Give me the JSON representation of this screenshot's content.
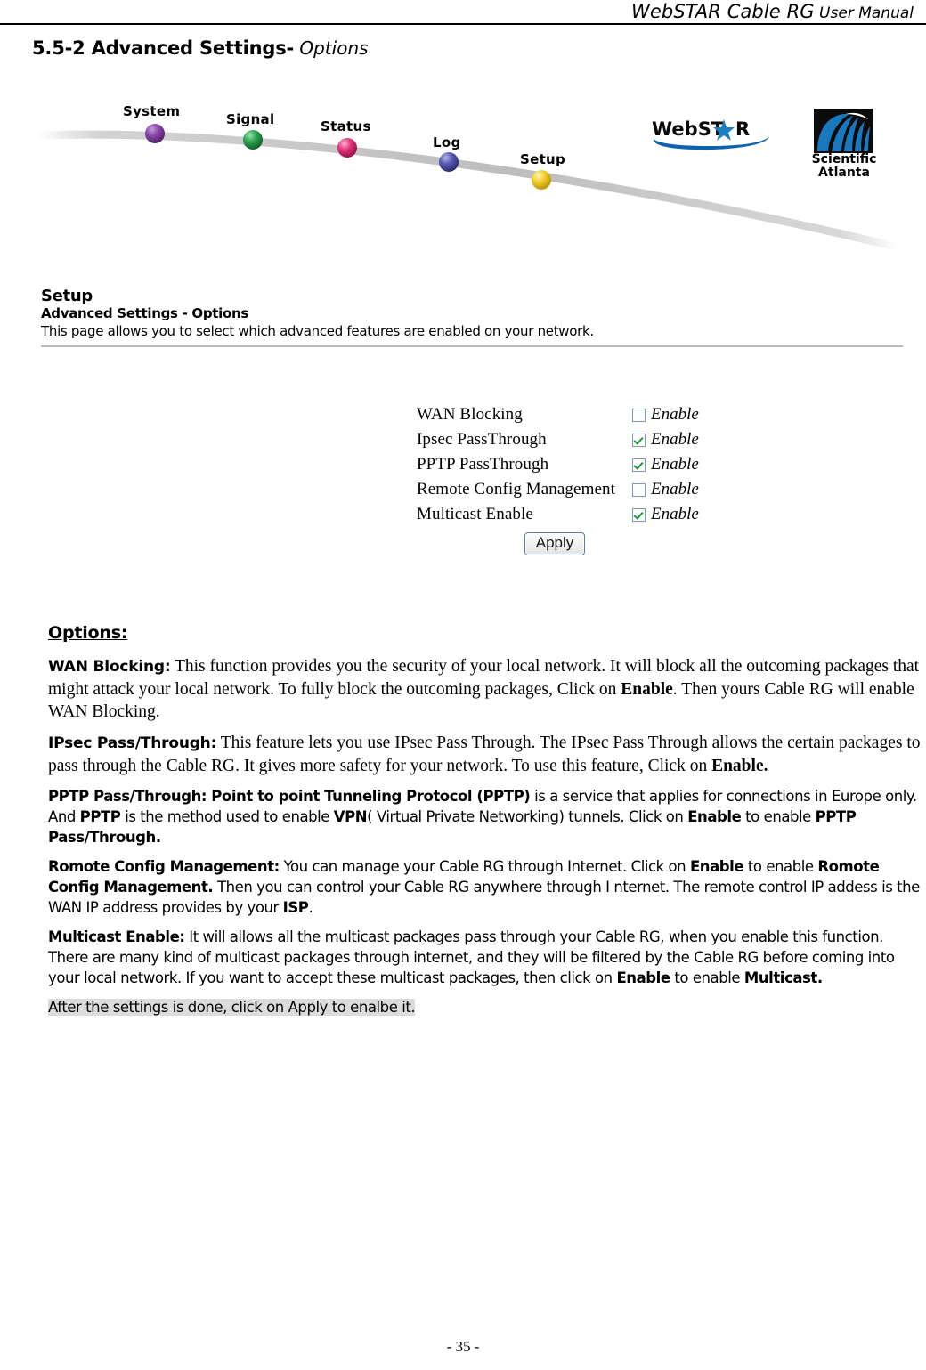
{
  "header": {
    "title_main": "WebSTAR Cable RG",
    "title_sub": " User Manual"
  },
  "section": {
    "number_title": "5.5-2 Advanced Settings-",
    "subtitle": " Options"
  },
  "router_ui": {
    "nav": {
      "items": [
        {
          "label": "System",
          "color": "#7b3fa0"
        },
        {
          "label": "Signal",
          "color": "#2aa34a"
        },
        {
          "label": "Status",
          "color": "#e0357e"
        },
        {
          "label": "Log",
          "color": "#5b5bb5"
        },
        {
          "label": "Setup",
          "color": "#f2cf2b"
        }
      ]
    },
    "brand": {
      "webstar": "WebST R",
      "webstar_prefix": "WebST",
      "webstar_suffix": "R",
      "scientific": "Scientific",
      "atlanta": "Atlanta"
    },
    "page_info": {
      "title": "Setup",
      "subtitle": "Advanced Settings - Options",
      "description": "This page allows you to select which advanced features are enabled on your network."
    },
    "form": {
      "rows": [
        {
          "label": "WAN Blocking",
          "enable_label": "Enable",
          "checked": false
        },
        {
          "label": "Ipsec PassThrough",
          "enable_label": "Enable",
          "checked": true
        },
        {
          "label": "PPTP PassThrough",
          "enable_label": "Enable",
          "checked": true
        },
        {
          "label": "Remote Config Management",
          "enable_label": "Enable",
          "checked": false
        },
        {
          "label": "Multicast Enable",
          "enable_label": "Enable",
          "checked": true
        }
      ],
      "apply_label": "Apply"
    }
  },
  "content": {
    "options_heading": "Options:",
    "wan": {
      "lead": "WAN Blocking:",
      "t1": "  This function provides you the security of your local network. It will block all the outcoming packages that might attack your local network. To fully block the outcoming packages, Click on ",
      "b1": "Enable",
      "t2": ".    Then yours Cable RG will enable WAN Blocking."
    },
    "ipsec": {
      "lead": "IPsec Pass/Through:",
      "t1": "  This feature lets you use IPsec Pass Through. The IPsec Pass Through allows the certain packages to pass through the Cable RG. It gives more safety for your network. To use this feature, Click on ",
      "b1": "Enable."
    },
    "pptp": {
      "lead": "PPTP Pass/Through:",
      "b1": "  Point to point Tunneling Protocol (PPTP)",
      "t1": " is a service that applies for connections in Europe only. And ",
      "b2": "PPTP",
      "t2": " is the method used to enable ",
      "b3": "VPN",
      "t3": "( Virtual Private Networking) tunnels. Click on ",
      "b4": "Enable",
      "t4": " to enable ",
      "b5": "PPTP Pass/Through."
    },
    "remote": {
      "lead": "Romote Config Management:",
      "t1": " You can manage your Cable RG through Internet. Click on ",
      "b1": "Enable",
      "t2": " to enable ",
      "b2": "Romote Config Management.",
      "t3": " Then you can control your Cable RG anywhere through I nternet. The remote control IP addess is the WAN IP address provides by your ",
      "b3": "ISP",
      "t4": "."
    },
    "multicast": {
      "lead": "Multicast Enable:",
      "t1": " It will allows all the multicast packages pass through your Cable RG, when you enable this function. There are many kind of multicast packages through internet, and they will be filtered by the Cable RG before coming into your local network. If you want to accept these multicast packages, then click on ",
      "b1": "Enable",
      "t2": " to enable ",
      "b2": "Multicast."
    },
    "tail_note": "After the settings is done, click on Apply to enalbe it."
  },
  "footer": {
    "page_number": "- 35 -"
  }
}
